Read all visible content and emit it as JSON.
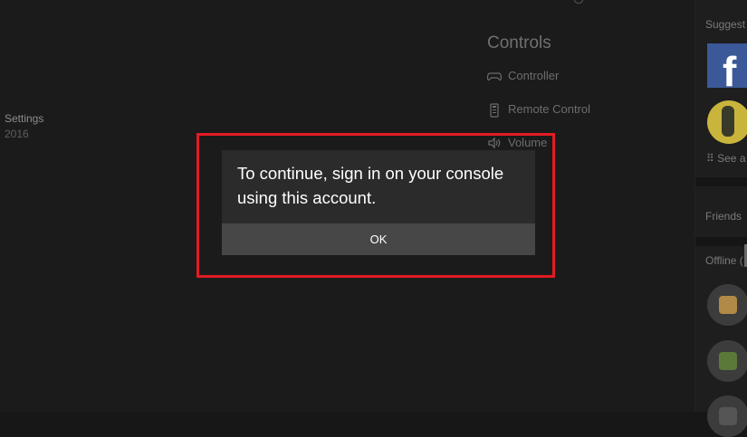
{
  "background": {
    "settings_label": "Settings",
    "year_label": "2016",
    "controls": {
      "title": "Controls",
      "items": [
        {
          "label": "Controller",
          "icon": "gamepad-icon"
        },
        {
          "label": "Remote Control",
          "icon": "remote-icon"
        },
        {
          "label": "Volume",
          "icon": "speaker-icon"
        }
      ]
    }
  },
  "right_panel": {
    "suggested_label": "Suggest",
    "suggested_items": [
      {
        "name": "facebook-tile",
        "glyph": "f",
        "color": "#3b5998"
      },
      {
        "name": "suggested-avatar",
        "color": "#c9b53c"
      }
    ],
    "see_all_label": "See a",
    "friends_label": "Friends",
    "offline_label": "Offline (",
    "friends": [
      {
        "icon": "bear-avatar-icon",
        "color": "#b08a46"
      },
      {
        "icon": "photo-avatar-icon",
        "color": "#5b7a3a"
      },
      {
        "icon": "avatar-icon",
        "color": "#555555"
      }
    ]
  },
  "dialog": {
    "message": "To continue, sign in on your console using this account.",
    "ok_label": "OK"
  },
  "colors": {
    "highlight": "#e21b24",
    "dialog_bg": "#2b2b2b",
    "button_bg": "#474747",
    "background": "#1b1b1b"
  }
}
